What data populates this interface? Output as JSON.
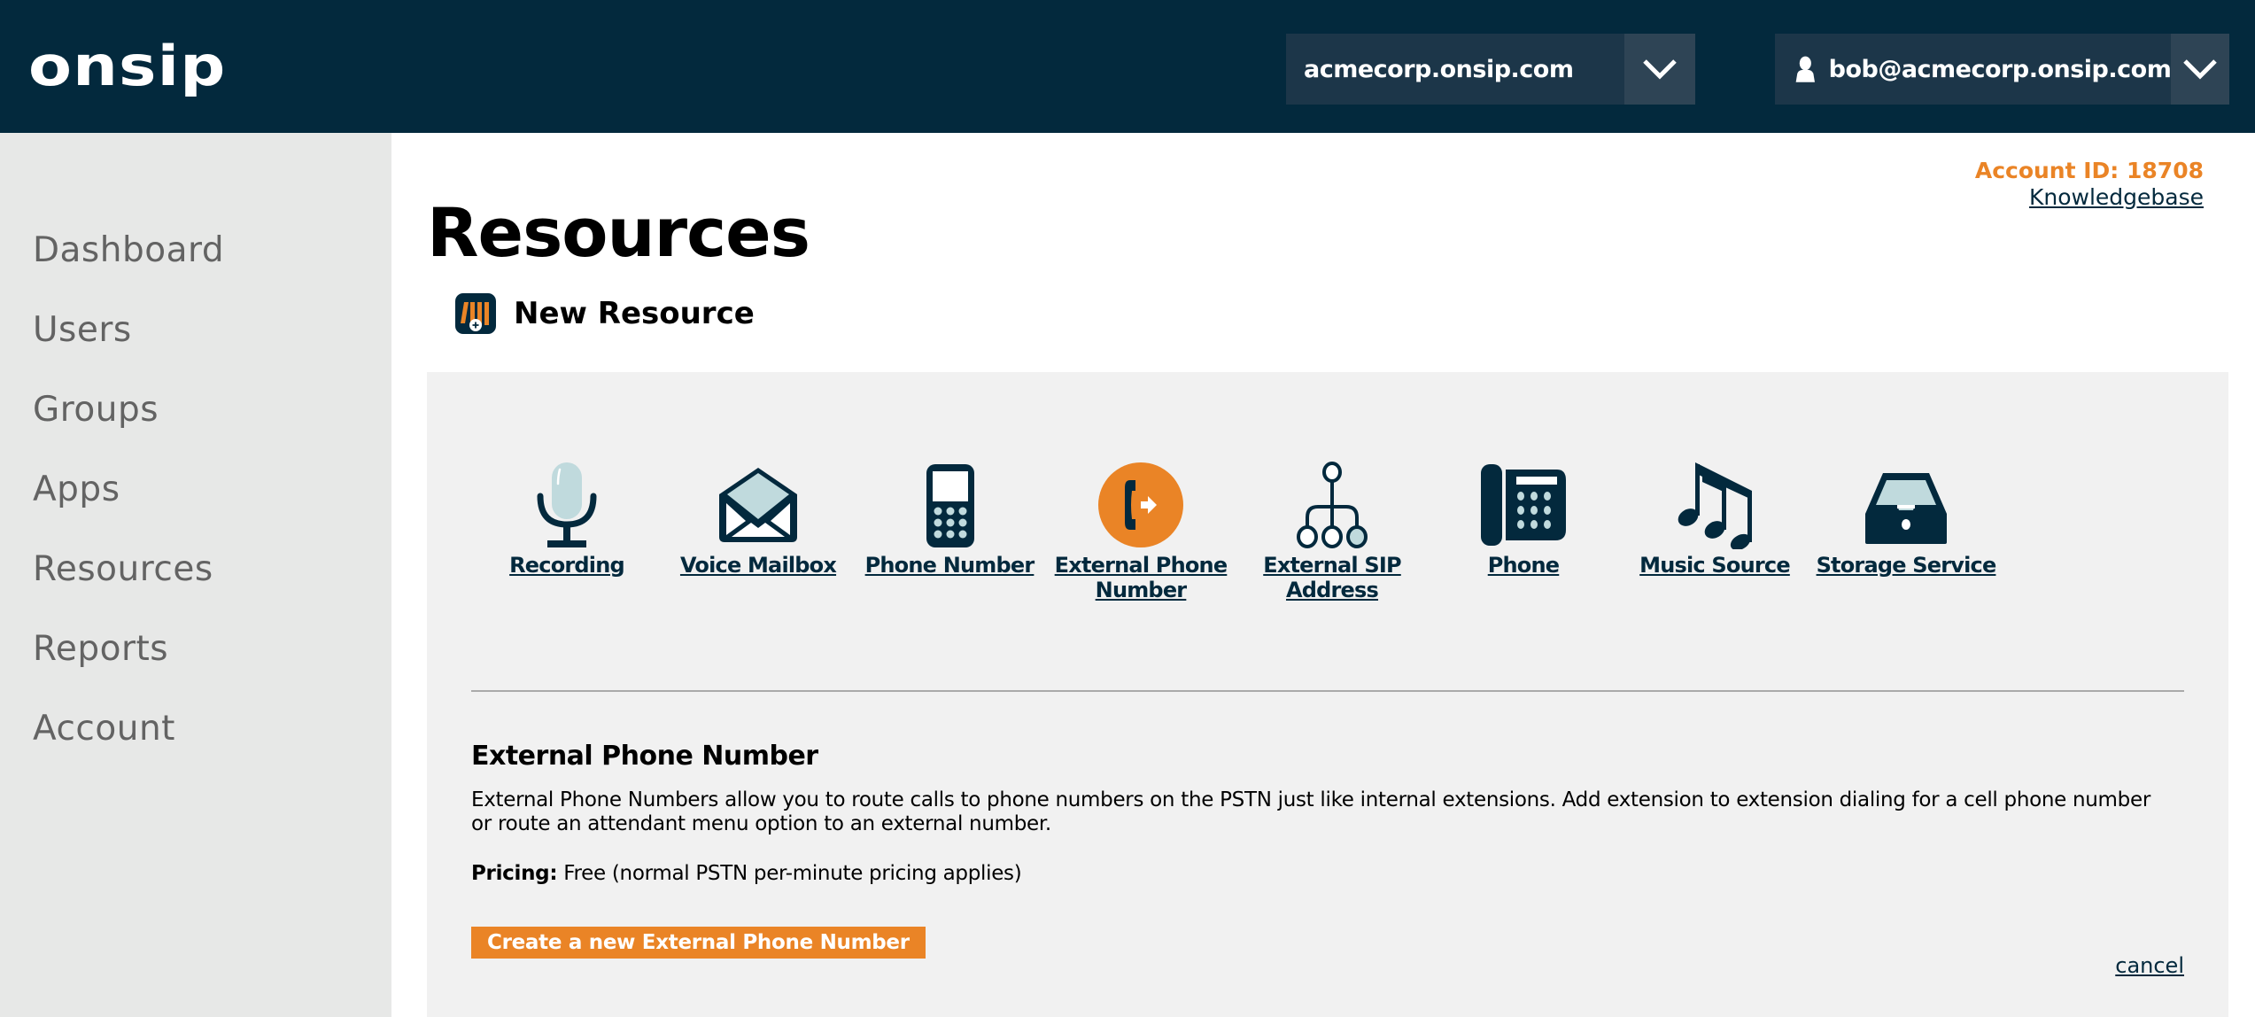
{
  "header": {
    "logo": "onsip",
    "domain_selector": "acmecorp.onsip.com",
    "user_selector": "bob@acmecorp.onsip.com"
  },
  "sidebar": {
    "items": [
      {
        "label": "Dashboard"
      },
      {
        "label": "Users"
      },
      {
        "label": "Groups"
      },
      {
        "label": "Apps"
      },
      {
        "label": "Resources"
      },
      {
        "label": "Reports"
      },
      {
        "label": "Account"
      }
    ]
  },
  "account": {
    "account_id_label": "Account ID: 18708",
    "knowledgebase_link": "Knowledgebase"
  },
  "main": {
    "title": "Resources",
    "subtitle": "New Resource",
    "resource_types": [
      {
        "label": "Recording",
        "icon": "microphone-icon"
      },
      {
        "label": "Voice Mailbox",
        "icon": "envelope-icon"
      },
      {
        "label": "Phone Number",
        "icon": "mobile-phone-icon"
      },
      {
        "label": "External Phone Number",
        "icon": "external-call-icon",
        "selected": true
      },
      {
        "label": "External SIP Address",
        "icon": "sip-tree-icon"
      },
      {
        "label": "Phone",
        "icon": "desk-phone-icon"
      },
      {
        "label": "Music Source",
        "icon": "music-note-icon"
      },
      {
        "label": "Storage Service",
        "icon": "storage-tray-icon"
      }
    ],
    "detail": {
      "title": "External Phone Number",
      "description": "External Phone Numbers allow you to route calls to phone numbers on the PSTN just like internal extensions. Add extension to extension dialing for a cell phone number or route an attendant menu option to an external number.",
      "pricing_label": "Pricing:",
      "pricing_value": "Free (normal PSTN per-minute pricing applies)",
      "create_button": "Create a new External Phone Number",
      "cancel_link": "cancel"
    }
  },
  "colors": {
    "header_bg": "#03293d",
    "accent_orange": "#ea8426",
    "link_navy": "#03293d",
    "sidebar_bg": "#e7e8e7",
    "panel_bg": "#f1f1f1",
    "icon_light": "#c0dadd"
  }
}
